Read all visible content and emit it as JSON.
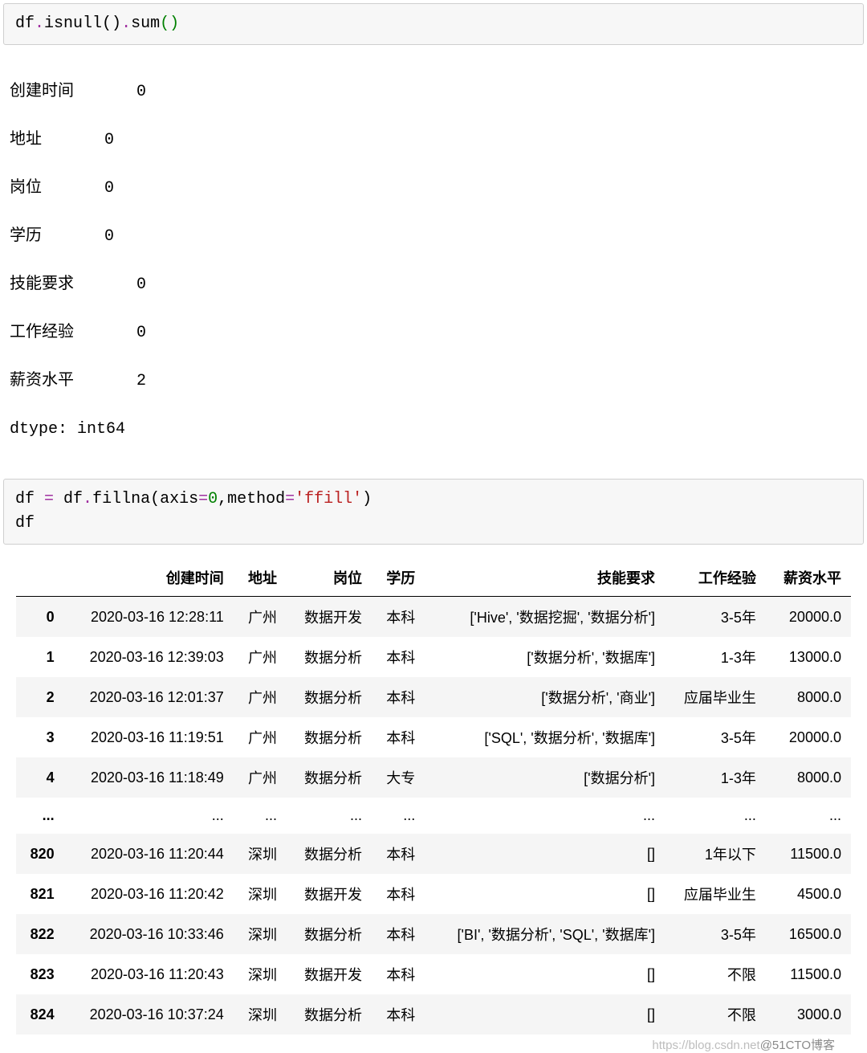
{
  "code1": {
    "p1": "df",
    "p2": ".",
    "p3": "isnull",
    "p4": "()",
    "p5": ".",
    "p6": "sum",
    "p7": "(",
    "p8": ")"
  },
  "output1": {
    "rows": [
      {
        "k": "创建时间",
        "v": "0"
      },
      {
        "k": "地址",
        "v": "0"
      },
      {
        "k": "岗位",
        "v": "0"
      },
      {
        "k": "学历",
        "v": "0"
      },
      {
        "k": "技能要求",
        "v": "0"
      },
      {
        "k": "工作经验",
        "v": "0"
      },
      {
        "k": "薪资水平",
        "v": "2"
      }
    ],
    "dtype": "dtype: int64"
  },
  "code2": {
    "p1": "df ",
    "op1": "=",
    "p2": " df",
    "p3": ".",
    "p4": "fillna",
    "p5": "(axis",
    "op2": "=",
    "num": "0",
    "p6": ",method",
    "op3": "=",
    "str": "'ffill'",
    "p7": ")",
    "line2": "df"
  },
  "table": {
    "headers": [
      "",
      "创建时间",
      "地址",
      "岗位",
      "学历",
      "技能要求",
      "工作经验",
      "薪资水平"
    ],
    "rows": [
      {
        "idx": "0",
        "c1": "2020-03-16 12:28:11",
        "c2": "广州",
        "c3": "数据开发",
        "c4": "本科",
        "c5": "['Hive', '数据挖掘', '数据分析']",
        "c6": "3-5年",
        "c7": "20000.0"
      },
      {
        "idx": "1",
        "c1": "2020-03-16 12:39:03",
        "c2": "广州",
        "c3": "数据分析",
        "c4": "本科",
        "c5": "['数据分析', '数据库']",
        "c6": "1-3年",
        "c7": "13000.0"
      },
      {
        "idx": "2",
        "c1": "2020-03-16 12:01:37",
        "c2": "广州",
        "c3": "数据分析",
        "c4": "本科",
        "c5": "['数据分析', '商业']",
        "c6": "应届毕业生",
        "c7": "8000.0"
      },
      {
        "idx": "3",
        "c1": "2020-03-16 11:19:51",
        "c2": "广州",
        "c3": "数据分析",
        "c4": "本科",
        "c5": "['SQL', '数据分析', '数据库']",
        "c6": "3-5年",
        "c7": "20000.0"
      },
      {
        "idx": "4",
        "c1": "2020-03-16 11:18:49",
        "c2": "广州",
        "c3": "数据分析",
        "c4": "大专",
        "c5": "['数据分析']",
        "c6": "1-3年",
        "c7": "8000.0"
      },
      {
        "idx": "...",
        "c1": "...",
        "c2": "...",
        "c3": "...",
        "c4": "...",
        "c5": "...",
        "c6": "...",
        "c7": "..."
      },
      {
        "idx": "820",
        "c1": "2020-03-16 11:20:44",
        "c2": "深圳",
        "c3": "数据分析",
        "c4": "本科",
        "c5": "[]",
        "c6": "1年以下",
        "c7": "11500.0"
      },
      {
        "idx": "821",
        "c1": "2020-03-16 11:20:42",
        "c2": "深圳",
        "c3": "数据开发",
        "c4": "本科",
        "c5": "[]",
        "c6": "应届毕业生",
        "c7": "4500.0"
      },
      {
        "idx": "822",
        "c1": "2020-03-16 10:33:46",
        "c2": "深圳",
        "c3": "数据分析",
        "c4": "本科",
        "c5": "['BI', '数据分析', 'SQL', '数据库']",
        "c6": "3-5年",
        "c7": "16500.0"
      },
      {
        "idx": "823",
        "c1": "2020-03-16 11:20:43",
        "c2": "深圳",
        "c3": "数据开发",
        "c4": "本科",
        "c5": "[]",
        "c6": "不限",
        "c7": "11500.0"
      },
      {
        "idx": "824",
        "c1": "2020-03-16 10:37:24",
        "c2": "深圳",
        "c3": "数据分析",
        "c4": "本科",
        "c5": "[]",
        "c6": "不限",
        "c7": "3000.0"
      }
    ]
  },
  "watermark": {
    "left": "https://blog.csdn.net",
    "right": "@51CTO博客"
  }
}
